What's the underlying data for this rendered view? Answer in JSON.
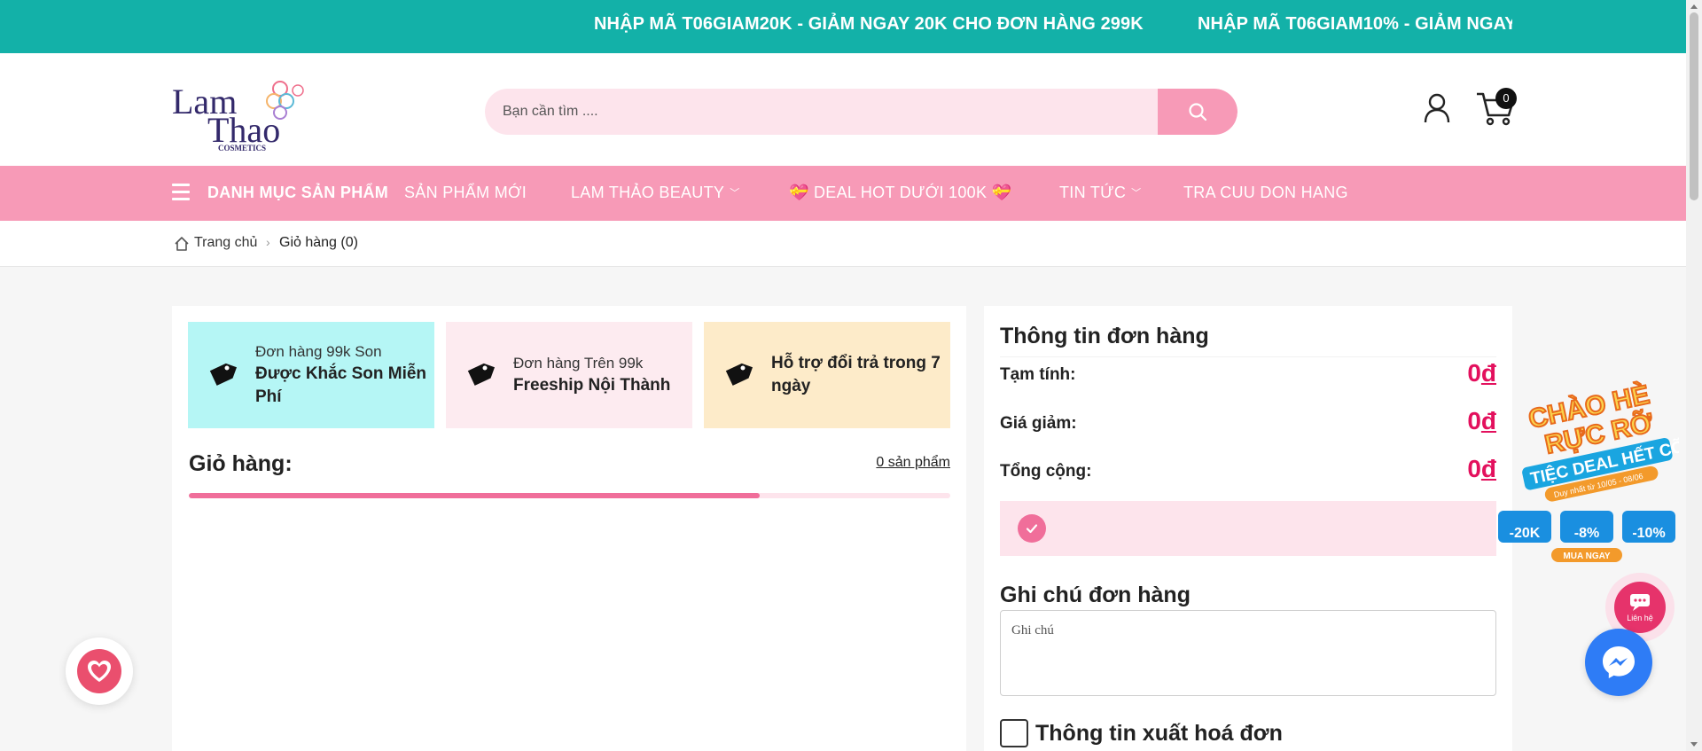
{
  "promo": {
    "messages": [
      "NHẬP MÃ T06GIAM20K - GIẢM NGAY 20K CHO ĐƠN HÀNG 299K",
      "NHẬP MÃ T06GIAM10% - GIẢM NGAY"
    ]
  },
  "header": {
    "logo": {
      "line1": "Lam",
      "line2": "Thao",
      "sub": "COSMETICS"
    },
    "search": {
      "placeholder": "Bạn cần tìm ...."
    },
    "cart_count": "0"
  },
  "nav": {
    "items": [
      {
        "label": "DANH MỤC SẢN PHẨM",
        "has_dropdown": false
      },
      {
        "label": "SẢN PHẨM MỚI",
        "has_dropdown": false
      },
      {
        "label": "LAM THẢO BEAUTY",
        "has_dropdown": true
      },
      {
        "label": "💝 DEAL HOT DƯỚI 100K 💝",
        "has_dropdown": false
      },
      {
        "label": "TIN TỨC",
        "has_dropdown": true
      },
      {
        "label": "TRA CUU DON HANG",
        "has_dropdown": false
      }
    ]
  },
  "breadcrumb": {
    "home": "Trang chủ",
    "current": "Giỏ hàng (0)"
  },
  "policies": [
    {
      "small": "Đơn hàng 99k Son",
      "big": "Được Khắc Son Miễn Phí",
      "bg": "#b5f6f5"
    },
    {
      "small": "Đơn hàng Trên 99k",
      "big": "Freeship Nội Thành",
      "bg": "#fdebf0"
    },
    {
      "small": "",
      "big": "Hỗ trợ đổi trả trong 7 ngày",
      "bg": "#fdebc9"
    }
  ],
  "cart": {
    "title": "Giỏ hàng:",
    "count_label": "0 sản phẩm",
    "progress_fraction": 0.75
  },
  "summary": {
    "title": "Thông tin đơn hàng",
    "subtotal_label": "Tạm tính:",
    "subtotal_value": "0",
    "discount_label": "Giá giảm:",
    "discount_value": "0",
    "total_label": "Tổng cộng:",
    "total_value": "0",
    "currency": "đ",
    "note_title": "Ghi chú đơn hàng",
    "note_placeholder": "Ghi chú",
    "invoice_label": "Thông tin xuất hoá đơn"
  },
  "floating": {
    "promo_badge": {
      "line1": "CHÀO HÈ",
      "line2": "RỰC RỠ",
      "line3": "TIỆC DEAL HẾT CỠ",
      "dates": "Duy nhất từ 10/05 - 08/06",
      "coupons": [
        "-20K",
        "-8%",
        "-10%"
      ],
      "cta": "MUA NGAY"
    },
    "contact_label": "Liên hệ"
  },
  "colors": {
    "teal": "#13b1a8",
    "pink": "#f79ab7",
    "price_red": "#e3105d"
  }
}
